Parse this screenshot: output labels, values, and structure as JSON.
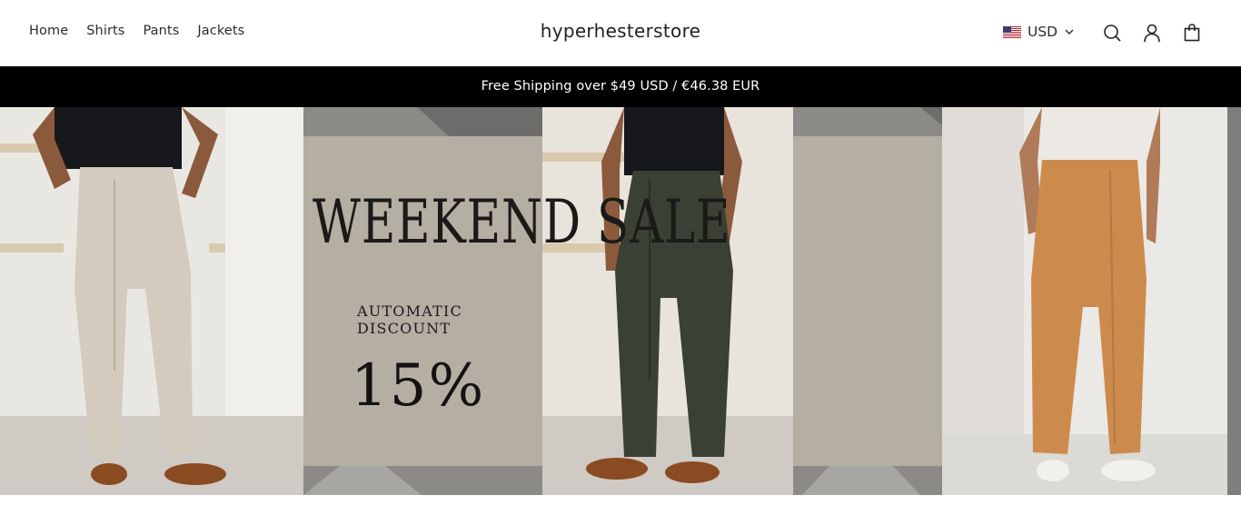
{
  "header": {
    "nav": [
      "Home",
      "Shirts",
      "Pants",
      "Jackets"
    ],
    "logo": "hyperhesterstore",
    "currency": {
      "flag": "us-flag-icon",
      "code": "USD"
    },
    "icons": [
      "search-icon",
      "account-icon",
      "cart-icon"
    ]
  },
  "announcement": "Free Shipping over $49 USD / €46.38 EUR",
  "hero": {
    "title": "WEEKEND SALE",
    "subtitle_line1": "AUTOMATIC",
    "subtitle_line2": "DISCOUNT",
    "discount": "15%"
  },
  "colors": {
    "announcement_bg": "#000000",
    "hero_beige": "#b4aea3",
    "accent_grey": "#8a8a8a"
  }
}
